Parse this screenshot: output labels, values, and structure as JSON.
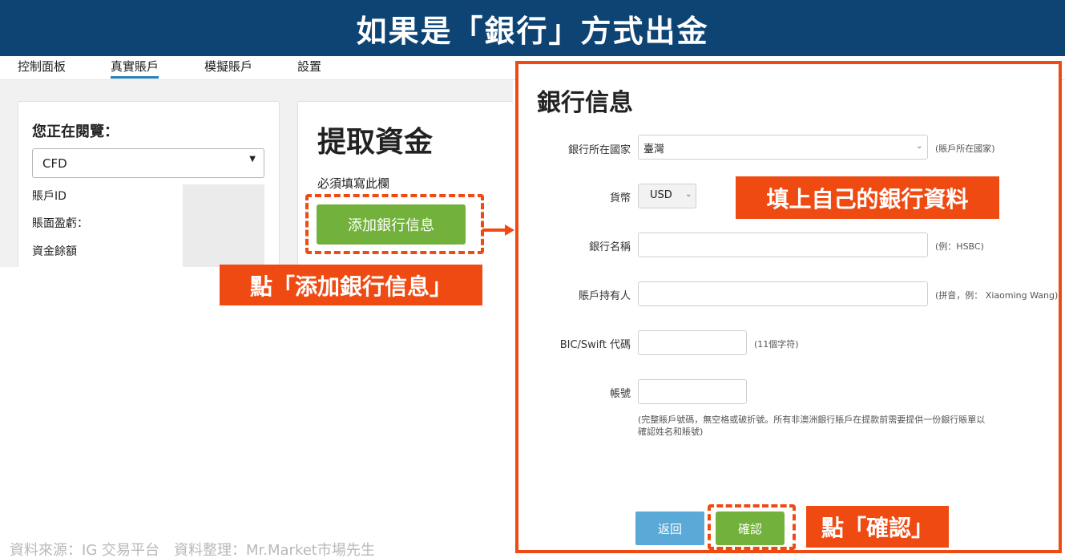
{
  "banner": {
    "title": "如果是「銀行」方式出金"
  },
  "nav": {
    "tabs": [
      "控制面板",
      "真實賬戶",
      "模擬賬戶",
      "設置"
    ],
    "active_index": 1
  },
  "account_card": {
    "title": "您正在閱覽：",
    "account_type": "CFD",
    "rows": [
      "賬戶ID",
      "賬面盈虧：",
      "資金餘額"
    ]
  },
  "withdraw_card": {
    "title": "提取資金",
    "required_note": "必須填寫此欄",
    "add_bank_button": "添加銀行信息"
  },
  "annotations": {
    "click_add_bank": "點「添加銀行信息」",
    "fill_bank_info": "填上自己的銀行資料",
    "click_confirm": "點「確認」"
  },
  "bank_form": {
    "title": "銀行信息",
    "country": {
      "label": "銀行所在國家",
      "value": "臺灣",
      "hint": "(賬戶所在國家)"
    },
    "currency": {
      "label": "貨幣",
      "value": "USD"
    },
    "bank_name": {
      "label": "銀行名稱",
      "value": "",
      "hint": "(例：HSBC)"
    },
    "account_holder": {
      "label": "賬戶持有人",
      "value": "",
      "hint": "(拼音，例： Xiaoming Wang)"
    },
    "bic_swift": {
      "label": "BIC/Swift 代碼",
      "value": "",
      "hint": "(11個字符)"
    },
    "account_number": {
      "label": "帳號",
      "value": "",
      "note_line1": "(完整賬戶號碼，無空格或破折號。所有非澳洲銀行賬戶在提款前需要提供一份銀行賬單以",
      "note_line2": "確認姓名和賬號)"
    },
    "back_button": "返回",
    "confirm_button": "確認"
  },
  "colors": {
    "banner": "#0d4474",
    "accent_orange": "#ee4a12",
    "green_button": "#72b13b",
    "blue_button": "#5aa9d6",
    "active_tab": "#2a7fb8"
  },
  "source_note": "資料來源：IG 交易平台　資料整理：Mr.Market市場先生"
}
